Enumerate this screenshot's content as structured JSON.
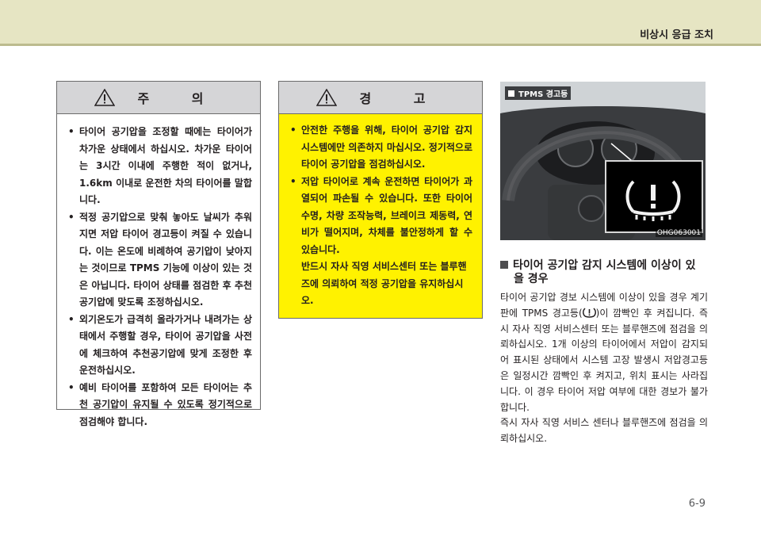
{
  "header": {
    "section_title": "비상시 응급 조치"
  },
  "caution": {
    "title": "주 의",
    "items": [
      "타이어 공기압을 조정할 때에는 타이어가 차가운 상태에서 하십시오. 차가운 타이어는 3시간 이내에 주행한 적이 없거나, 1.6km 이내로 운전한 차의 타이어를 말합니다.",
      "적정 공기압으로 맞춰 놓아도 날씨가 추워지면 저압 타이어 경고등이 켜질 수 있습니다. 이는 온도에 비례하여 공기압이 낮아지는 것이므로 TPMS 기능에 이상이 있는 것은 아닙니다. 타이어 상태를 점검한 후 추천 공기압에 맞도록 조정하십시오.",
      "외기온도가 급격히 올라가거나 내려가는 상태에서 주행할 경우, 타이어 공기압을 사전에 체크하여 추천공기압에 맞게 조정한 후 운전하십시오.",
      "예비 타이어를 포함하여 모든 타이어는 추천 공기압이 유지될 수 있도록 정기적으로 점검해야 합니다."
    ]
  },
  "warning": {
    "title": "경 고",
    "items": [
      "안전한 주행을 위해, 타이어 공기압 감지 시스템에만 의존하지 마십시오. 정기적으로 타이어 공기압을 점검하십시오.",
      "저압 타이어로 계속 운전하면 타이어가 과열되어 파손될 수 있습니다. 또한 타이어 수명, 차량 조작능력, 브레이크 제동력, 연비가 떨어지며, 차체를 불안정하게 할 수 있습니다."
    ],
    "extra": "반드시 자사 직영 서비스센터 또는 블루핸즈에 의뢰하여 적정 공기압을 유지하십시오."
  },
  "figure": {
    "label": "TPMS 경고등",
    "code": "OHG063001",
    "icon": "tpms-warning-icon"
  },
  "section": {
    "heading_line1": "타이어 공기압 감지 시스템에 이상이 있",
    "heading_line2": "을 경우",
    "para1_before_icon": "타이어 공기압 경보 시스템에 이상이 있을 경우 계기판에 TPMS 경고등(",
    "para1_after_icon": ")이 깜빡인 후 켜집니다. 즉시 자사 직영 서비스센터 또는 블루핸즈에 점검을 의뢰하십시오. 1개 이상의 타이어에서 저압이 감지되어 표시된 상태에서 시스템 고장 발생시 저압경고등은 일정시간 깜빡인 후 켜지고, 위치 표시는 사라집니다. 이 경우 타이어 저압 여부에 대한 경보가 불가합니다.",
    "para2": "즉시 자사 직영 서비스 센터나 블루핸즈에 점검을 의뢰하십시오."
  },
  "page_number": "6-9",
  "colors": {
    "topbar": "#e6e5c3",
    "warning_bg": "#fff200",
    "box_head": "#d5d5d7"
  }
}
